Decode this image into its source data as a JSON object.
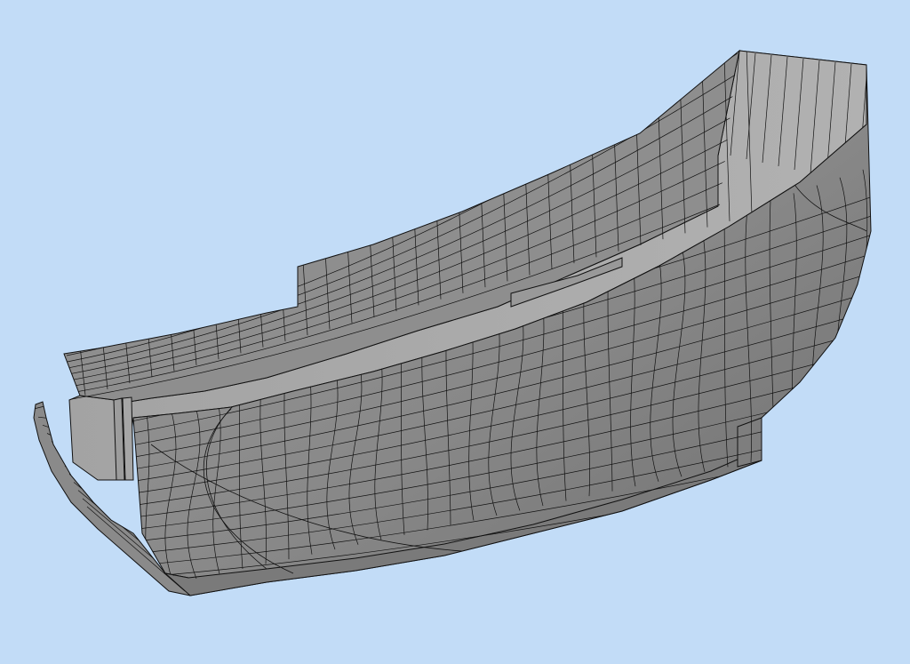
{
  "viewport": {
    "background": "#c2dcf7",
    "model": "ship-hull",
    "render_mode": "shaded-wireframe",
    "colors": {
      "hull_outer": "#8b8b8b",
      "hull_inner": "#a7a7a7",
      "hull_dark": "#6f6f6f",
      "edge": "#111111"
    }
  }
}
